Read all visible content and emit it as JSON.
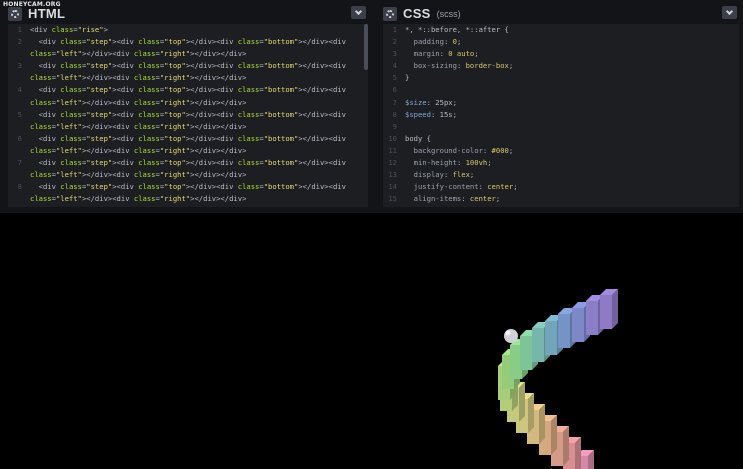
{
  "watermark": "HONEYCAM.ORG",
  "html_panel": {
    "title": "HTML",
    "lines": [
      {
        "n": "1",
        "text": "<div class=\"rise\">"
      },
      {
        "n": "2",
        "text": "  <div class=\"step\"><div class=\"top\"></div><div class=\"bottom\"></div><div"
      },
      {
        "n": "",
        "text": "class=\"left\"></div><div class=\"right\"></div></div>"
      },
      {
        "n": "3",
        "text": "  <div class=\"step\"><div class=\"top\"></div><div class=\"bottom\"></div><div"
      },
      {
        "n": "",
        "text": "class=\"left\"></div><div class=\"right\"></div></div>"
      },
      {
        "n": "4",
        "text": "  <div class=\"step\"><div class=\"top\"></div><div class=\"bottom\"></div><div"
      },
      {
        "n": "",
        "text": "class=\"left\"></div><div class=\"right\"></div></div>"
      },
      {
        "n": "5",
        "text": "  <div class=\"step\"><div class=\"top\"></div><div class=\"bottom\"></div><div"
      },
      {
        "n": "",
        "text": "class=\"left\"></div><div class=\"right\"></div></div>"
      },
      {
        "n": "6",
        "text": "  <div class=\"step\"><div class=\"top\"></div><div class=\"bottom\"></div><div"
      },
      {
        "n": "",
        "text": "class=\"left\"></div><div class=\"right\"></div></div>"
      },
      {
        "n": "7",
        "text": "  <div class=\"step\"><div class=\"top\"></div><div class=\"bottom\"></div><div"
      },
      {
        "n": "",
        "text": "class=\"left\"></div><div class=\"right\"></div></div>"
      },
      {
        "n": "8",
        "text": "  <div class=\"step\"><div class=\"top\"></div><div class=\"bottom\"></div><div"
      },
      {
        "n": "",
        "text": "class=\"left\"></div><div class=\"right\"></div></div>"
      }
    ]
  },
  "css_panel": {
    "title": "CSS",
    "subtitle": "(scss)",
    "lines": [
      {
        "n": "1",
        "text": "*, *::before, *::after {"
      },
      {
        "n": "2",
        "text": "  padding: 0;"
      },
      {
        "n": "3",
        "text": "  margin: 0 auto;"
      },
      {
        "n": "4",
        "text": "  box-sizing: border-box;"
      },
      {
        "n": "5",
        "text": "}"
      },
      {
        "n": "6",
        "text": ""
      },
      {
        "n": "7",
        "text": "$size: 25px;"
      },
      {
        "n": "8",
        "text": "$speed: 15s;"
      },
      {
        "n": "9",
        "text": ""
      },
      {
        "n": "10",
        "text": "body {"
      },
      {
        "n": "11",
        "text": "  background-color: #000;"
      },
      {
        "n": "12",
        "text": "  min-height: 100vh;"
      },
      {
        "n": "13",
        "text": "  display: flex;"
      },
      {
        "n": "14",
        "text": "  justify-content: center;"
      },
      {
        "n": "15",
        "text": "  align-items: center;"
      }
    ]
  },
  "colors": {
    "editor_bg": "#1d1e22",
    "chrome_bg": "#131417",
    "result_bg": "#000000"
  },
  "icons": [
    "gear-icon",
    "chevron-down-icon"
  ]
}
